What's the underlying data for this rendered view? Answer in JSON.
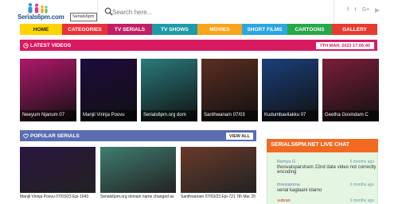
{
  "header": {
    "logo_text": "Serials6pm.com",
    "logo_tag": "Serials6pm",
    "search_placeholder": "Search here...",
    "socials": [
      "f",
      "t",
      "G+",
      "▶"
    ]
  },
  "nav": [
    {
      "label": "HOME",
      "bg": "#ffd400",
      "fg": "#222222",
      "active": true
    },
    {
      "label": "CATEGORIES",
      "bg": "#e7323b",
      "fg": "#ffffff"
    },
    {
      "label": "TV SERIALS",
      "bg": "#c01f66",
      "fg": "#ffffff"
    },
    {
      "label": "TV SHOWS",
      "bg": "#1f9aa7",
      "fg": "#ffffff"
    },
    {
      "label": "MOVIES",
      "bg": "#f7a51c",
      "fg": "#ffffff"
    },
    {
      "label": "SHORT FILMS",
      "bg": "#2ba6e0",
      "fg": "#ffffff"
    },
    {
      "label": "CARTOONS",
      "bg": "#27a848",
      "fg": "#ffffff"
    },
    {
      "label": "GALLERY",
      "bg": "#e63c2f",
      "fg": "#ffffff"
    }
  ],
  "latest": {
    "title": "LATEST VIDEOS",
    "date": "7TH MAR, 2023 17:06:40",
    "cards": [
      {
        "caption": "Neeyum Njanum 07",
        "art": "#b0186b"
      },
      {
        "caption": "Manjil Virinja Poovu",
        "art": "#1d0b3d"
      },
      {
        "caption": "Serials6pm.org dom",
        "art": "#2a7b7c"
      },
      {
        "caption": "Santhwanam 07/03",
        "art": "#5b2e22"
      },
      {
        "caption": "Kudumbavilakku 07",
        "art": "#1b3f7a"
      },
      {
        "caption": "Geetha Govindam C",
        "art": "#7b1e3a"
      }
    ]
  },
  "popular": {
    "title": "POPULAR SERIALS",
    "view_all": "VIEW ALL",
    "items": [
      {
        "caption": "Manjil Virinja Poovu 07/03/23 Epi-1043",
        "art": "#2a1640"
      },
      {
        "caption": "Serials6pm.org domain name changed as",
        "art": "#3f7e70"
      },
      {
        "caption": "Santhwanam 07/03/23 Epi-721 7th Mar 20",
        "art": "#6a3a2a"
      }
    ]
  },
  "chat": {
    "title": "SERIALS6PM.NET LIVE CHAT",
    "messages": [
      {
        "user": "Remya G",
        "ago": "6 months ago",
        "text": "thoovalsparsham 22nd date video not correctly encoding"
      },
      {
        "user": "thresiamma",
        "ago": "6 months ago",
        "text": "serial kaglaani idamo"
      },
      {
        "user": "subran",
        "ago": "6 months ago",
        "text": ""
      }
    ]
  }
}
